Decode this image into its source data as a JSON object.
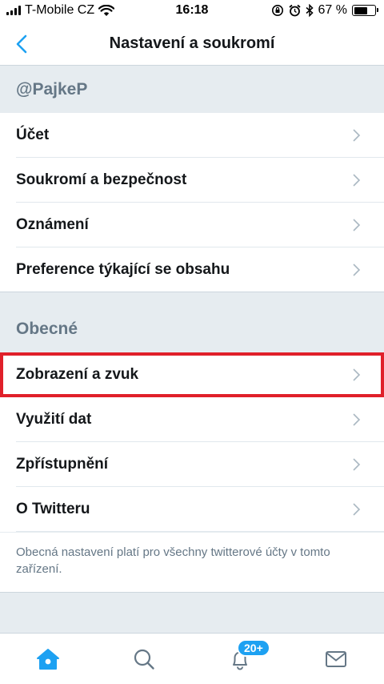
{
  "status_bar": {
    "carrier": "T-Mobile CZ",
    "time": "16:18",
    "battery_percent": "67 %",
    "battery_level": 0.67
  },
  "nav": {
    "title": "Nastavení a soukromí",
    "back_icon": "chevron-left-icon"
  },
  "account_section": {
    "header": "@PajkeP",
    "items": [
      {
        "label": "Účet"
      },
      {
        "label": "Soukromí a bezpečnost"
      },
      {
        "label": "Oznámení"
      },
      {
        "label": "Preference týkající se obsahu"
      }
    ]
  },
  "general_section": {
    "header": "Obecné",
    "items": [
      {
        "label": "Zobrazení a zvuk",
        "highlighted": true
      },
      {
        "label": "Využití dat"
      },
      {
        "label": "Zpřístupnění"
      },
      {
        "label": "O Twitteru"
      }
    ],
    "footer_note": "Obecná nastavení platí pro všechny twitterové účty v tomto zařízení."
  },
  "tab_bar": {
    "tabs": [
      {
        "icon": "home-icon",
        "active": true
      },
      {
        "icon": "search-icon"
      },
      {
        "icon": "bell-icon"
      },
      {
        "icon": "mail-icon"
      }
    ],
    "notifications_badge": "20+"
  },
  "colors": {
    "accent": "#1da1f2",
    "highlight_box": "#e0202a",
    "section_bg": "#e6ecf0",
    "muted_text": "#657786"
  }
}
